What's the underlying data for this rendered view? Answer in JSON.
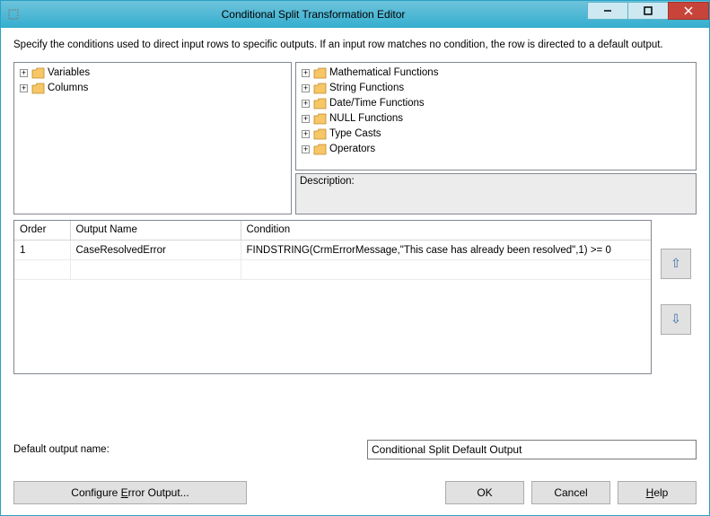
{
  "window": {
    "title": "Conditional Split Transformation Editor"
  },
  "tooltip": "Specify the conditions used to direct input rows to specific outputs. If an input row matches no condition, the row is directed to a default output.",
  "left_tree": {
    "items": [
      {
        "label": "Variables"
      },
      {
        "label": "Columns"
      }
    ]
  },
  "right_tree": {
    "items": [
      {
        "label": "Mathematical Functions"
      },
      {
        "label": "String Functions"
      },
      {
        "label": "Date/Time Functions"
      },
      {
        "label": "NULL Functions"
      },
      {
        "label": "Type Casts"
      },
      {
        "label": "Operators"
      }
    ]
  },
  "desc_label": "Description:",
  "grid": {
    "headers": {
      "order": "Order",
      "output": "Output Name",
      "condition": "Condition"
    },
    "rows": [
      {
        "order": "1",
        "output": "CaseResolvedError",
        "condition": "FINDSTRING(CrmErrorMessage,\"This case has already been resolved\",1) >= 0"
      }
    ]
  },
  "default_output": {
    "label": "Default output name:",
    "value": "Conditional Split Default Output"
  },
  "buttons": {
    "configure": "Configure Error Output...",
    "ok": "OK",
    "cancel": "Cancel",
    "help": "Help"
  }
}
